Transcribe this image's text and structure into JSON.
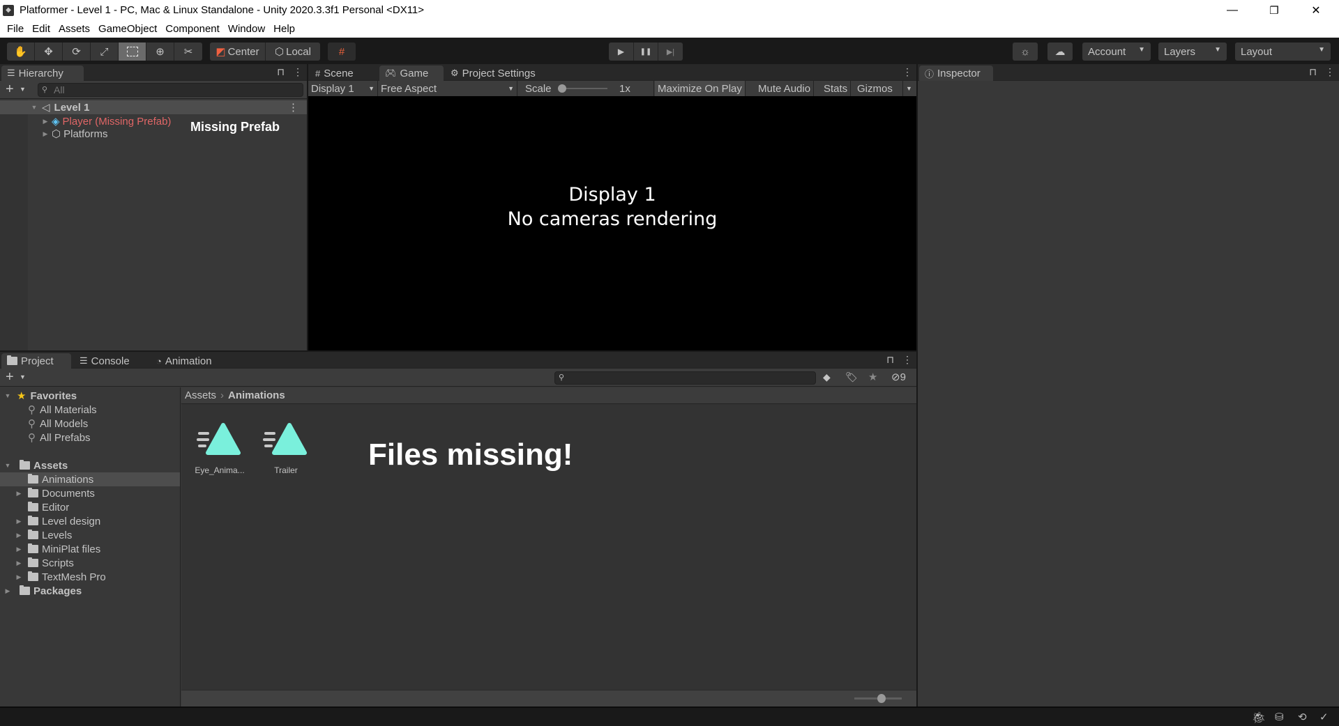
{
  "window": {
    "title": "Platformer - Level 1 - PC, Mac & Linux Standalone - Unity 2020.3.3f1 Personal <DX11>",
    "controls": {
      "minimize": "—",
      "restore": "❐",
      "close": "✕"
    }
  },
  "menu": [
    "File",
    "Edit",
    "Assets",
    "GameObject",
    "Component",
    "Window",
    "Help"
  ],
  "toolbar": {
    "tools": [
      "hand-tool",
      "move-tool",
      "rotate-tool",
      "scale-tool",
      "rect-tool",
      "transform-tool",
      "custom-tool"
    ],
    "active_tool": "rect-tool",
    "pivot_label": "Center",
    "space_label": "Local",
    "play": "▶",
    "pause": "❚❚",
    "step": "▶|",
    "account_label": "Account",
    "layers_label": "Layers",
    "layout_label": "Layout"
  },
  "hierarchy": {
    "tab_label": "Hierarchy",
    "search_placeholder": "All",
    "scene": "Level 1",
    "items": [
      {
        "label": "Player (Missing Prefab)",
        "state": "missing",
        "color": "#e06666"
      },
      {
        "label": "Platforms",
        "state": "normal"
      }
    ],
    "annotation": "Missing Prefab"
  },
  "center": {
    "tabs": [
      "Scene",
      "Game",
      "Project Settings"
    ],
    "active_tab": "Game",
    "game_toolbar": {
      "display": "Display 1",
      "aspect": "Free Aspect",
      "scale_label": "Scale",
      "scale_value": "1x",
      "maximize": "Maximize On Play",
      "mute": "Mute Audio",
      "stats": "Stats",
      "gizmos": "Gizmos"
    },
    "message_line1": "Display 1",
    "message_line2": "No cameras rendering"
  },
  "inspector": {
    "tab_label": "Inspector"
  },
  "bottom": {
    "tabs": [
      "Project",
      "Console",
      "Animation"
    ],
    "active_tab": "Project",
    "hidden_count": "9",
    "favorites": {
      "label": "Favorites",
      "items": [
        "All Materials",
        "All Models",
        "All Prefabs"
      ]
    },
    "assets": {
      "label": "Assets",
      "items": [
        {
          "label": "Animations",
          "expandable": false,
          "selected": true
        },
        {
          "label": "Documents",
          "expandable": true
        },
        {
          "label": "Editor",
          "expandable": false
        },
        {
          "label": "Level design",
          "expandable": true
        },
        {
          "label": "Levels",
          "expandable": true
        },
        {
          "label": "MiniPlat files",
          "expandable": true
        },
        {
          "label": "Scripts",
          "expandable": true
        },
        {
          "label": "TextMesh Pro",
          "expandable": true
        }
      ]
    },
    "packages_label": "Packages",
    "breadcrumb": {
      "root": "Assets",
      "current": "Animations"
    },
    "files": [
      {
        "name": "Eye_Anima...",
        "icon": "animation-clip-icon",
        "color": "#7af0dc"
      },
      {
        "name": "Trailer",
        "icon": "animation-clip-icon",
        "color": "#7af0dc"
      }
    ],
    "annotation": "Files missing!",
    "thumb_size": 0.6
  }
}
